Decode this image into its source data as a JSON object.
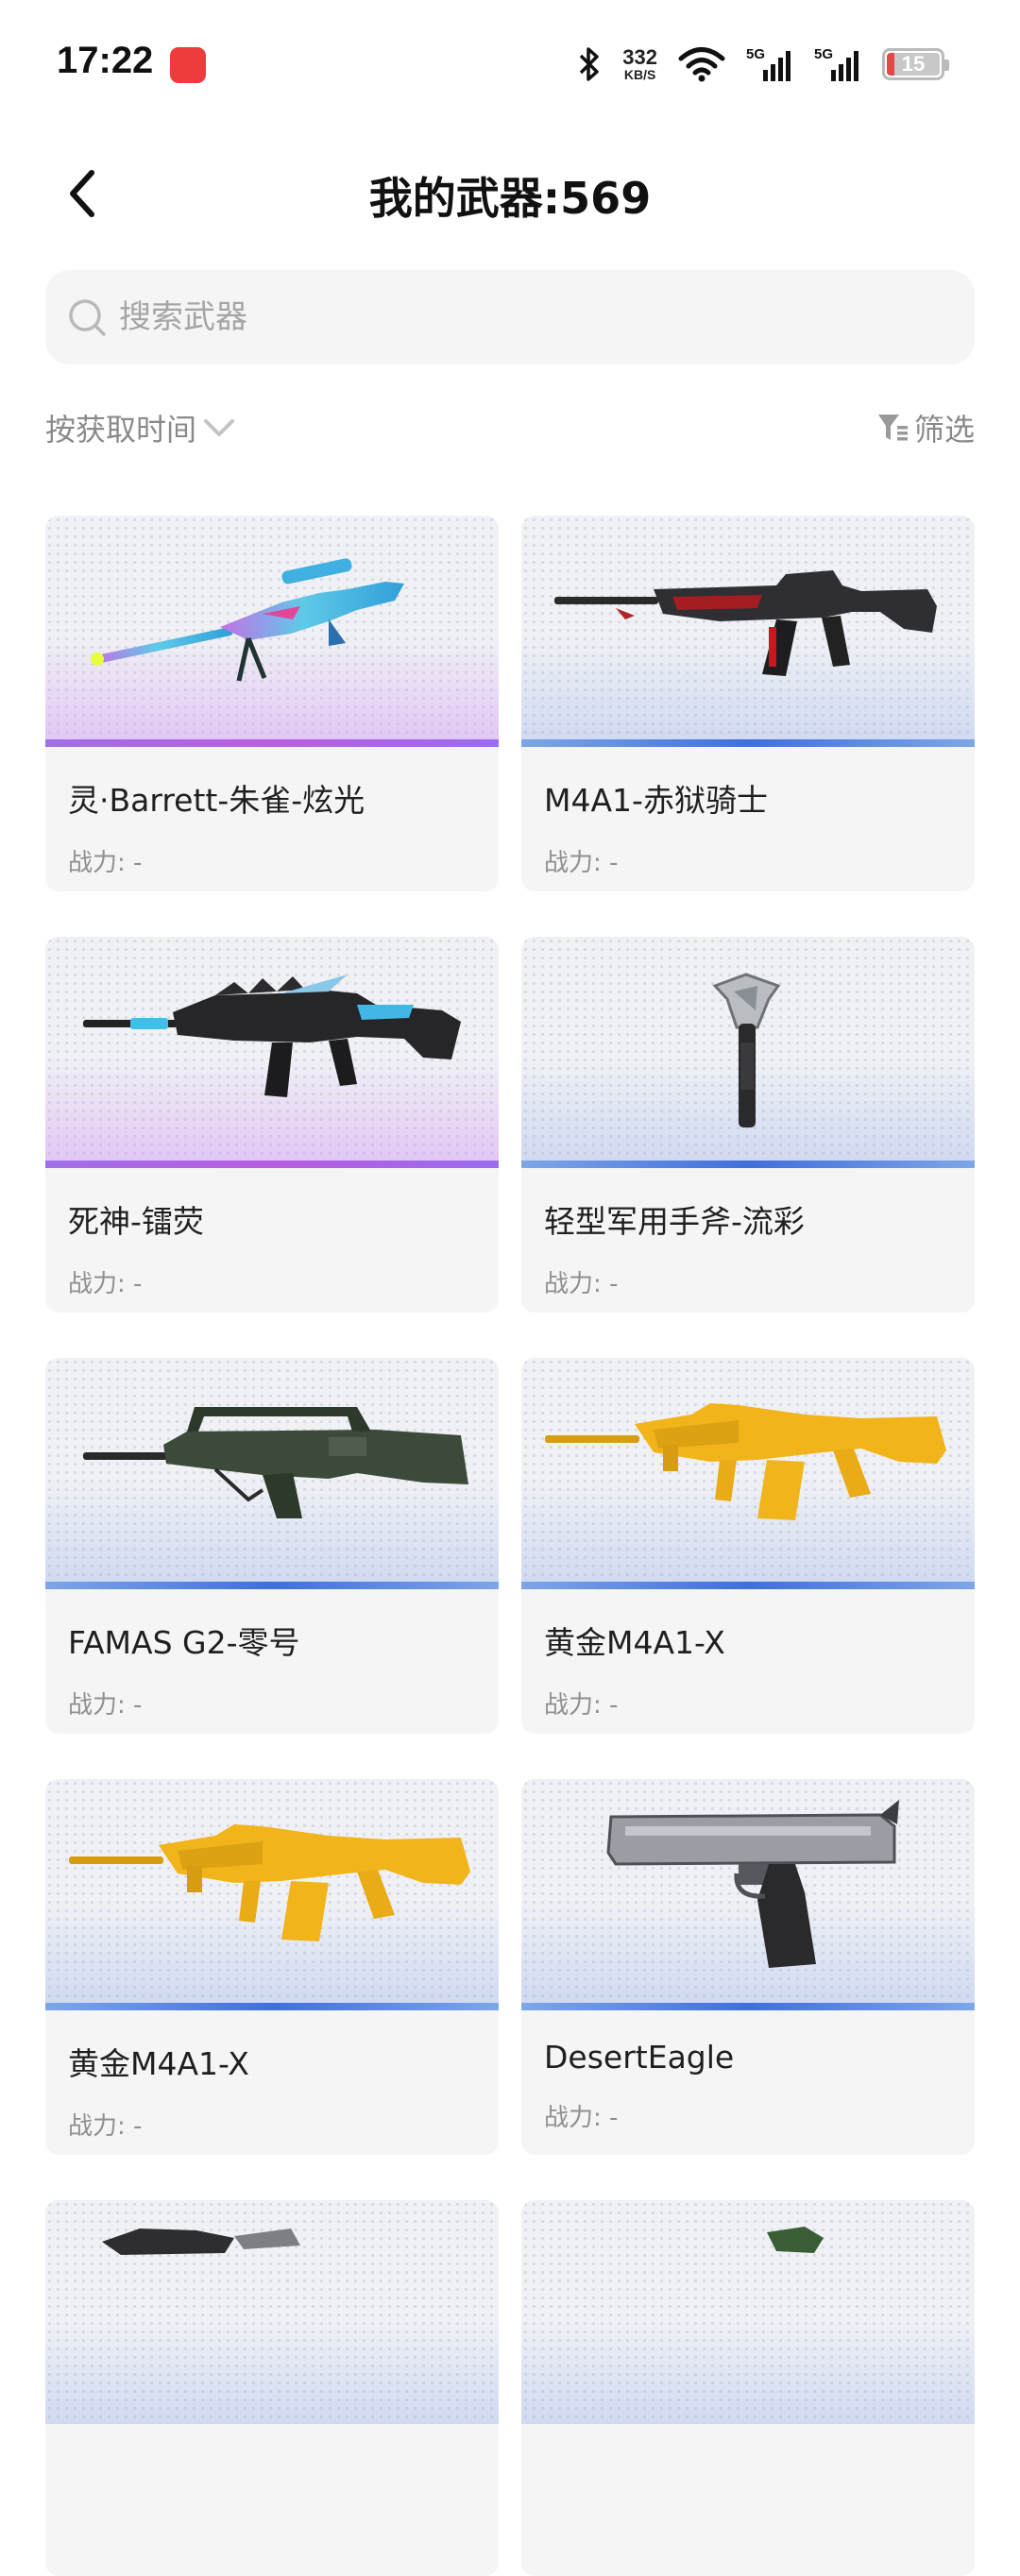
{
  "status_bar": {
    "time": "17:22",
    "net_speed_value": "332",
    "net_speed_unit": "KB/S",
    "signal_1_label": "5G",
    "signal_2_label": "5G",
    "battery_level": "15"
  },
  "header": {
    "title": "我的武器:569"
  },
  "search": {
    "placeholder": "搜索武器"
  },
  "toolbar": {
    "sort_label": "按获取时间",
    "filter_label": "筛选"
  },
  "weapons": [
    {
      "name": "灵·Barrett-朱雀-炫光",
      "power": "战力: -",
      "rarity": "purple",
      "icon": "sniper-rifle-icon"
    },
    {
      "name": "M4A1-赤狱骑士",
      "power": "战力: -",
      "rarity": "blue",
      "icon": "assault-rifle-icon"
    },
    {
      "name": "死神-镭荧",
      "power": "战力: -",
      "rarity": "purple",
      "icon": "assault-rifle-icon"
    },
    {
      "name": "轻型军用手斧-流彩",
      "power": "战力: -",
      "rarity": "blue",
      "icon": "hatchet-icon"
    },
    {
      "name": "FAMAS G2-零号",
      "power": "战力: -",
      "rarity": "blue",
      "icon": "bullpup-rifle-icon"
    },
    {
      "name": "黄金M4A1-X",
      "power": "战力: -",
      "rarity": "blue",
      "icon": "gold-rifle-icon"
    },
    {
      "name": "黄金M4A1-X",
      "power": "战力: -",
      "rarity": "blue",
      "icon": "gold-rifle-icon"
    },
    {
      "name": "DesertEagle",
      "power": "战力: -",
      "rarity": "blue",
      "icon": "pistol-icon"
    }
  ],
  "colors": {
    "purple_rarity": "#b05ee6",
    "blue_rarity": "#3f6fdc",
    "gold": "#f1b51b"
  }
}
